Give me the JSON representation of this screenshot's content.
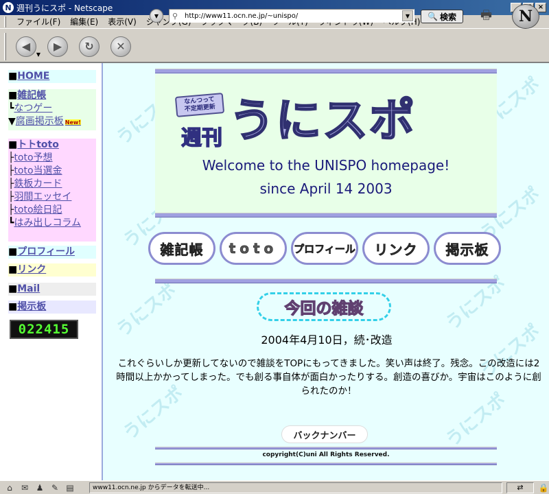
{
  "window": {
    "title": "週刊うにスポ - Netscape",
    "controls": [
      "_",
      "□",
      "×"
    ]
  },
  "menu": [
    "ファイル(F)",
    "編集(E)",
    "表示(V)",
    "ジャンプ(G)",
    "ブックマーク(B)",
    "ツール(T)",
    "ウィンドウ(W)",
    "ヘルプ(H)"
  ],
  "toolbar": {
    "url": "http://www11.ocn.ne.jp/~unispo/",
    "search_label": "検索"
  },
  "sidebar": {
    "home": "HOME",
    "zakki": "雑記帳",
    "zakki_items": [
      "なつゲー",
      "腐画掲示板"
    ],
    "new_badge": "New!",
    "toto": "トトtoto",
    "toto_items": [
      "toto予想",
      "toto当選金",
      "鉄板カード",
      "羽間エッセイ",
      "toto絵日記",
      "はみ出しコラム"
    ],
    "profile": "プロフィール",
    "link": "リンク",
    "mail": "Mail",
    "bbs": "掲示板",
    "counter": "022415"
  },
  "banner": {
    "tagline_1": "なんつって",
    "tagline_2": "不定期更新",
    "weekly": "週刊",
    "logo": "うにスポ",
    "welcome": "Welcome to the UNISPO homepage!",
    "since": "since April 14 2003"
  },
  "nav_buttons": [
    "雑記帳",
    "toto",
    "プロフィール",
    "リンク",
    "掲示板"
  ],
  "topic": {
    "heading": "今回の雑談",
    "date": "2004年4月10日，続･改造",
    "body": "これぐらいしか更新してないので雑談をTOPにもってきました。笑い声は終了。残念。この改造には2時間以上かかってしまった。でも創る事自体が面白かったりする。創造の喜びか。宇宙はこのように創られたのか！"
  },
  "back_number": "バックナンバー",
  "footer": "copyright(C)uni All Rights Reserved.",
  "status": {
    "text": "www11.ocn.ne.jp からデータを転送中..."
  }
}
